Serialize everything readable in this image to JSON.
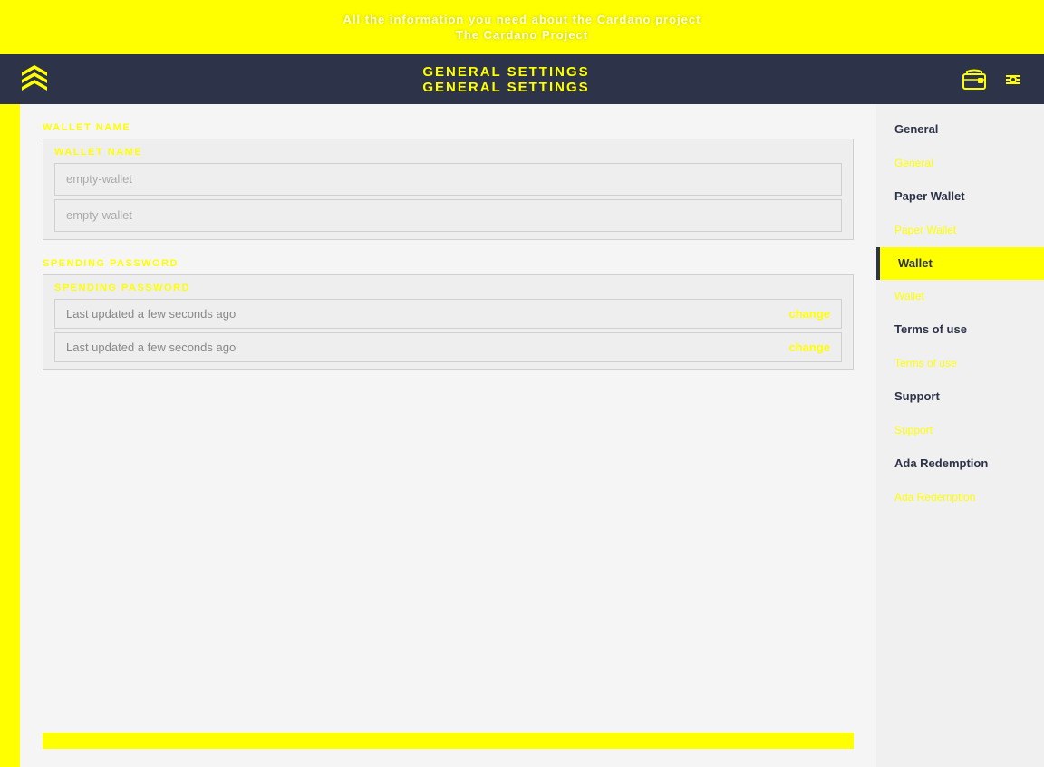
{
  "topBanner": {
    "line1": "All the information you need about the Cardano project",
    "line2": "The Cardano Project"
  },
  "navbar": {
    "title1": "GENERAL SETTINGS",
    "title2": "GENERAL SETTINGS",
    "logoAlt": "Daedalus logo"
  },
  "form": {
    "walletNameLabel": "WALLET NAME",
    "walletNameLabel2": "WALLET NAME",
    "walletNameValue": "empty-wallet",
    "walletNameValue2": "empty-wallet",
    "spendingPasswordLabel": "SPENDING PASSWORD",
    "spendingPasswordLabel2": "SPENDING PASSWORD",
    "spendingPasswordValue1": "Last updated a few seconds ago",
    "spendingPasswordValue2": "Last updated a few seconds ago",
    "changeLabel1": "change",
    "changeLabel2": "change"
  },
  "sidebar": {
    "items": [
      {
        "id": "general1",
        "primary": "General",
        "secondary": "",
        "active": false
      },
      {
        "id": "general2",
        "primary": "General",
        "secondary": "",
        "active": false
      },
      {
        "id": "paper-wallet1",
        "primary": "Paper Wallet",
        "secondary": "",
        "active": false
      },
      {
        "id": "paper-wallet2",
        "primary": "Paper Wallet",
        "secondary": "",
        "active": false
      },
      {
        "id": "wallet1",
        "primary": "Wallet",
        "secondary": "",
        "active": true
      },
      {
        "id": "wallet2",
        "primary": "Wallet",
        "secondary": "",
        "active": false
      },
      {
        "id": "terms1",
        "primary": "Terms of use",
        "secondary": "",
        "active": false
      },
      {
        "id": "terms2",
        "primary": "Terms of use",
        "secondary": "",
        "active": false
      },
      {
        "id": "support1",
        "primary": "Support",
        "secondary": "",
        "active": false
      },
      {
        "id": "support2",
        "primary": "Support",
        "secondary": "",
        "active": false
      },
      {
        "id": "ada-redemption1",
        "primary": "Ada Redemption",
        "secondary": "",
        "active": false
      },
      {
        "id": "ada-redemption2",
        "primary": "Ada Redemption",
        "secondary": "",
        "active": false
      }
    ]
  },
  "colors": {
    "yellow": "#ffff00",
    "dark": "#2d3348",
    "activeBar": "#ffff00"
  }
}
